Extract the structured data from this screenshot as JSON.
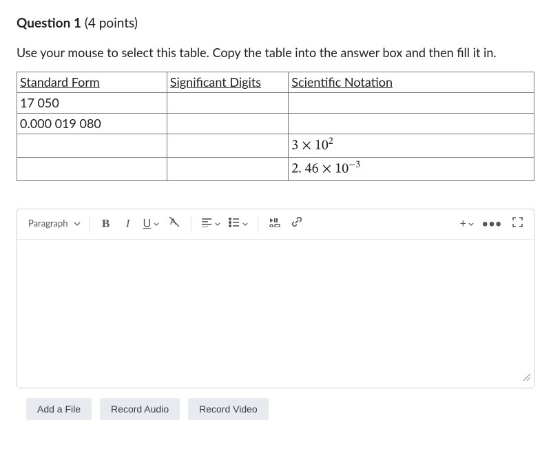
{
  "question": {
    "label": "Question 1",
    "points": "(4 points)",
    "instructions": "Use your mouse to select this table.  Copy the table into the answer box and then fill it in."
  },
  "table": {
    "headers": [
      "Standard Form",
      "Significant Digits",
      "Scientific Notation"
    ],
    "rows": [
      {
        "standard": "17 050",
        "sigdigits": "",
        "scinot": ""
      },
      {
        "standard": "0.000 019 080",
        "sigdigits": "",
        "scinot": ""
      },
      {
        "standard": "",
        "sigdigits": "",
        "scinot_html": "3 × 10<sup>2</sup>"
      },
      {
        "standard": "",
        "sigdigits": "",
        "scinot_html": "2. 46 × 10<sup>−3</sup>"
      }
    ]
  },
  "editor": {
    "format_label": "Paragraph",
    "icons": {
      "bold": "B",
      "italic": "I",
      "underline": "U",
      "textcolor": "A",
      "plus": "+",
      "more": "•••"
    }
  },
  "actions": {
    "add_file": "Add a File",
    "record_audio": "Record Audio",
    "record_video": "Record Video"
  }
}
